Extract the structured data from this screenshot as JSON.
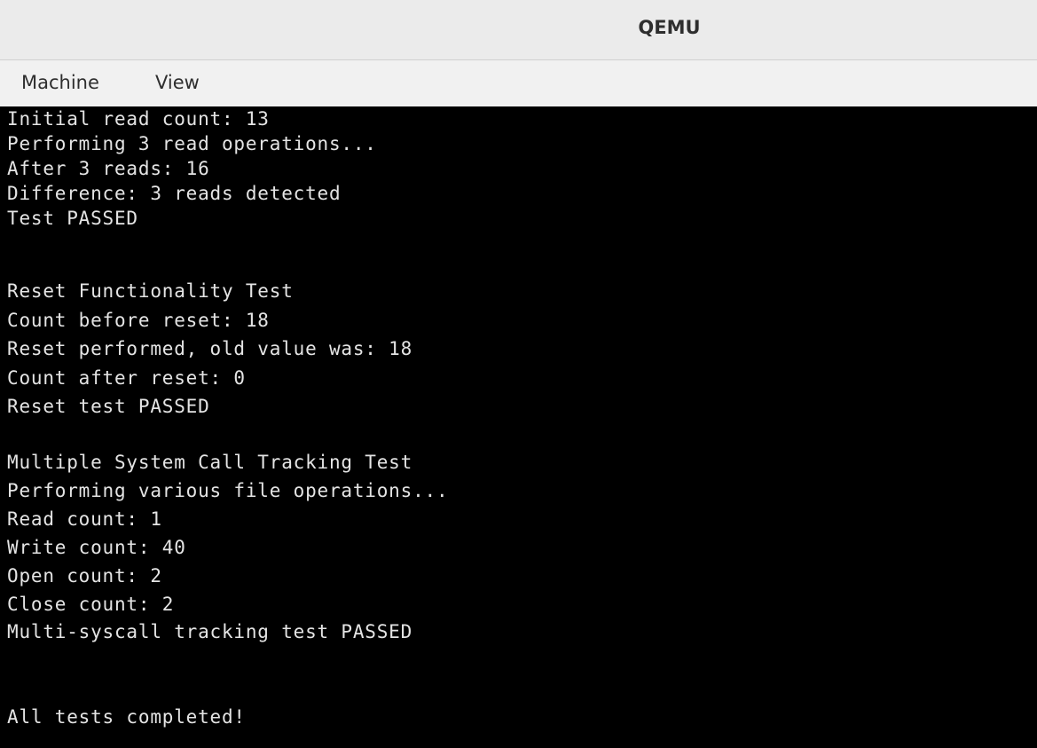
{
  "window": {
    "title": "QEMU"
  },
  "menubar": {
    "items": [
      "Machine",
      "View"
    ]
  },
  "console": {
    "lines": [
      "Initial read count: 13",
      "Performing 3 read operations...",
      "After 3 reads: 16",
      "Difference: 3 reads detected",
      "Test PASSED",
      "",
      "Reset Functionality Test",
      "Count before reset: 18",
      "Reset performed, old value was: 18",
      "Count after reset: 0",
      "Reset test PASSED",
      "",
      "Multiple System Call Tracking Test",
      "Performing various file operations...",
      "Read count: 1",
      "Write count: 40",
      "Open count: 2",
      "Close count: 2",
      "Multi-syscall tracking test PASSED",
      "",
      "",
      "All tests completed!"
    ],
    "colors": {
      "background": "#000000",
      "text": "#e4e4e4"
    }
  }
}
